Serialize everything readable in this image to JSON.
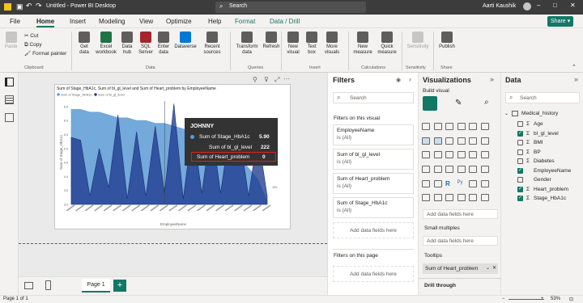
{
  "title": {
    "file": "Untitled - Power BI Desktop",
    "search": "Search",
    "user": "Aarti Kaushik"
  },
  "menu": [
    "File",
    "Home",
    "Insert",
    "Modeling",
    "View",
    "Optimize",
    "Help",
    "Format",
    "Data / Drill"
  ],
  "share": "Share",
  "ribbon": {
    "clipboard": {
      "paste": "Paste",
      "cut": "Cut",
      "copy": "Copy",
      "format_painter": "Format painter",
      "group": "Clipboard"
    },
    "data": {
      "buttons": [
        "Get data",
        "Excel workbook",
        "Data hub",
        "SQL Server",
        "Enter data",
        "Dataverse",
        "Recent sources"
      ],
      "group": "Data"
    },
    "queries": {
      "buttons": [
        "Transform data",
        "Refresh"
      ],
      "group": "Queries"
    },
    "insert": {
      "buttons": [
        "New visual",
        "Text box",
        "More visuals"
      ],
      "group": "Insert"
    },
    "calc": {
      "buttons": [
        "New measure",
        "Quick measure"
      ],
      "group": "Calculations"
    },
    "sens": {
      "buttons": [
        "Sensitivity"
      ],
      "group": "Sensitivity"
    },
    "share": {
      "buttons": [
        "Publish"
      ],
      "group": "Share"
    }
  },
  "chart_data": {
    "type": "area",
    "title": "Sum of Stage_HbA1c, Sum of bl_gl_level and Sum of Heart_problem by EmployeeName",
    "xlabel": "EmployeeName",
    "ylabel": "Sum of Stage_HbA1c",
    "legend": [
      "Sum of Stage_HbA1c",
      "Sum of bl_gl_level"
    ],
    "y_ticks": [
      "6.5",
      "6.0",
      "5.5",
      "5.0",
      "4.5",
      "4.0",
      "3.5",
      "3.0"
    ],
    "y2_ticks": [
      "200",
      "150",
      "100"
    ],
    "ylim": [
      3,
      6.7
    ],
    "series": [
      {
        "name": "Sum of Stage_HbA1c",
        "values": [
          6.4,
          6.4,
          6.3,
          6.3,
          6.2,
          6.1,
          6.1,
          6.0,
          6.0,
          5.9,
          5.9,
          5.8,
          5.7,
          5.6,
          5.5,
          5.3,
          5.2,
          5.0,
          4.7,
          4.3,
          3.9,
          3.1
        ]
      },
      {
        "name": "Sum of bl_gl_level",
        "values": [
          5.4,
          5.3,
          3.3,
          5.0,
          3.6,
          6.2,
          3.2,
          5.6,
          3.3,
          5.8,
          3.4,
          6.6,
          3.2,
          5.8,
          3.4,
          5.9,
          3.4,
          5.7,
          5.6,
          3.3,
          5.5,
          3.3
        ]
      }
    ],
    "color_area": "#5b9bd5",
    "color_area2": "#1f3b8f"
  },
  "tooltip": {
    "name": "JOHNNY",
    "rows": [
      {
        "label": "Sum of Stage_HbA1c",
        "value": "5.90"
      },
      {
        "label": "Sum of bl_gl_level",
        "value": "222"
      },
      {
        "label": "Sum of Heart_problem",
        "value": "0"
      }
    ]
  },
  "filters": {
    "title": "Filters",
    "search": "Search",
    "section": "Filters on this visual",
    "items": [
      {
        "name": "EmployeeName",
        "state": "is (All)"
      },
      {
        "name": "Sum of bl_gl_level",
        "state": "is (All)"
      },
      {
        "name": "Sum of Heart_problem",
        "state": "is (All)"
      },
      {
        "name": "Sum of Stage_HbA1c",
        "state": "is (All)"
      }
    ],
    "add": "Add data fields here",
    "page_section": "Filters on this page",
    "page_add": "Add data fields here"
  },
  "viz": {
    "title": "Visualizations",
    "build": "Build visual",
    "add": "Add data fields here",
    "small_multiples": "Small multiples",
    "sm_add": "Add data fields here",
    "tooltips": "Tooltips",
    "tooltip_field": "Sum of Heart_problem",
    "drill": "Drill through"
  },
  "data": {
    "title": "Data",
    "search": "Search",
    "table": "Medical_history",
    "fields": [
      {
        "name": "Age",
        "sigma": true,
        "checked": false
      },
      {
        "name": "bl_gl_level",
        "sigma": true,
        "checked": true
      },
      {
        "name": "BMI",
        "sigma": true,
        "checked": false
      },
      {
        "name": "BP",
        "sigma": true,
        "checked": false
      },
      {
        "name": "Diabetes",
        "sigma": true,
        "checked": false
      },
      {
        "name": "EmployeeName",
        "sigma": false,
        "checked": true
      },
      {
        "name": "Gender",
        "sigma": false,
        "checked": false
      },
      {
        "name": "Heart_problem",
        "sigma": true,
        "checked": true
      },
      {
        "name": "Stage_HbA1c",
        "sigma": true,
        "checked": true
      }
    ]
  },
  "page_tab": "Page 1",
  "status": {
    "page": "Page 1 of 1",
    "zoom": "53%"
  }
}
